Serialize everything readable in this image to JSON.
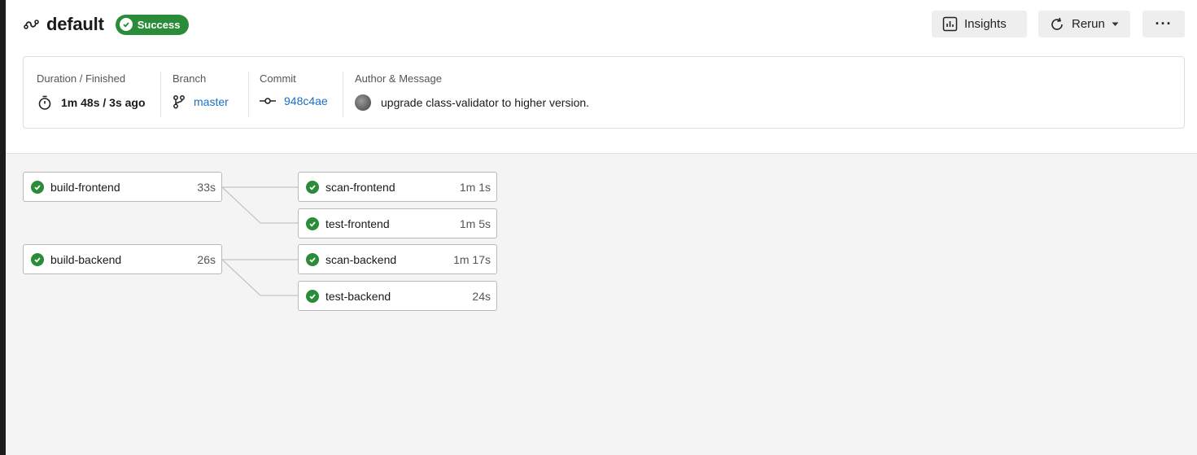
{
  "header": {
    "title": "default",
    "status": "Success",
    "buttons": {
      "insights": "Insights",
      "rerun": "Rerun",
      "more": "···"
    }
  },
  "info": {
    "duration": {
      "label": "Duration / Finished",
      "value": "1m 48s / 3s ago"
    },
    "branch": {
      "label": "Branch",
      "value": "master"
    },
    "commit": {
      "label": "Commit",
      "value": "948c4ae"
    },
    "author": {
      "label": "Author & Message",
      "message": "upgrade class-validator to higher version."
    }
  },
  "jobs": [
    {
      "name": "build-frontend",
      "duration": "33s",
      "status": "success"
    },
    {
      "name": "scan-frontend",
      "duration": "1m 1s",
      "status": "success"
    },
    {
      "name": "test-frontend",
      "duration": "1m 5s",
      "status": "success"
    },
    {
      "name": "build-backend",
      "duration": "26s",
      "status": "success"
    },
    {
      "name": "scan-backend",
      "duration": "1m 17s",
      "status": "success"
    },
    {
      "name": "test-backend",
      "duration": "24s",
      "status": "success"
    }
  ],
  "colors": {
    "success": "#2a8b38",
    "link": "#1b6fc4",
    "background": "#f4f4f4"
  }
}
